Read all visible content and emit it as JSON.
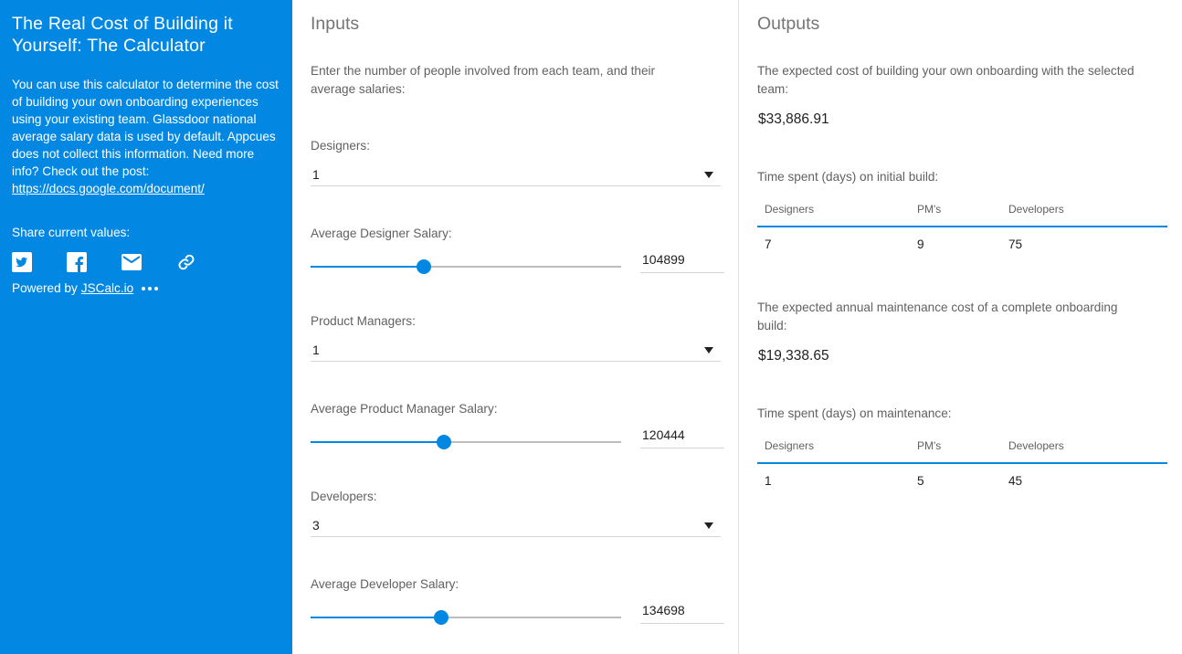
{
  "sidebar": {
    "title": "The Real Cost of Building it Yourself: The Calculator",
    "description": "You can use this calculator to determine the cost of building your own onboarding experiences using your existing team. Glassdoor national average salary data is used by default. Appcues does not collect this information. Need more info? Check out the post:",
    "post_link": "https://docs.google.com/document/",
    "share_label": "Share current values:",
    "share_icons": [
      "twitter-icon",
      "facebook-icon",
      "email-icon",
      "link-icon"
    ],
    "powered_prefix": "Powered by",
    "powered_link": "JSCalc.io",
    "accent_color": "#0288e2"
  },
  "inputs": {
    "heading": "Inputs",
    "intro": "Enter the number of people involved from each team, and their average salaries:",
    "designers_label": "Designers:",
    "designers_value": "1",
    "designer_salary_label": "Average Designer Salary:",
    "designer_salary_value": "104899",
    "designer_salary_fraction": 0.365,
    "pm_label": "Product Managers:",
    "pm_value": "1",
    "pm_salary_label": "Average Product Manager Salary:",
    "pm_salary_value": "120444",
    "pm_salary_fraction": 0.429,
    "developers_label": "Developers:",
    "developers_value": "3",
    "developer_salary_label": "Average Developer Salary:",
    "developer_salary_value": "134698",
    "developer_salary_fraction": 0.421
  },
  "outputs": {
    "heading": "Outputs",
    "build_cost_label": "The expected cost of building your own onboarding with the selected team:",
    "build_cost_value": "$33,886.91",
    "initial_build_label": "Time spent (days) on initial build:",
    "initial_build_table": {
      "headers": [
        "Designers",
        "PM's",
        "Developers"
      ],
      "row": [
        "7",
        "9",
        "75"
      ]
    },
    "maintenance_cost_label": "The expected annual maintenance cost of a complete onboarding build:",
    "maintenance_cost_value": "$19,338.65",
    "maintenance_label": "Time spent (days) on maintenance:",
    "maintenance_table": {
      "headers": [
        "Designers",
        "PM's",
        "Developers"
      ],
      "row": [
        "1",
        "5",
        "45"
      ]
    }
  }
}
